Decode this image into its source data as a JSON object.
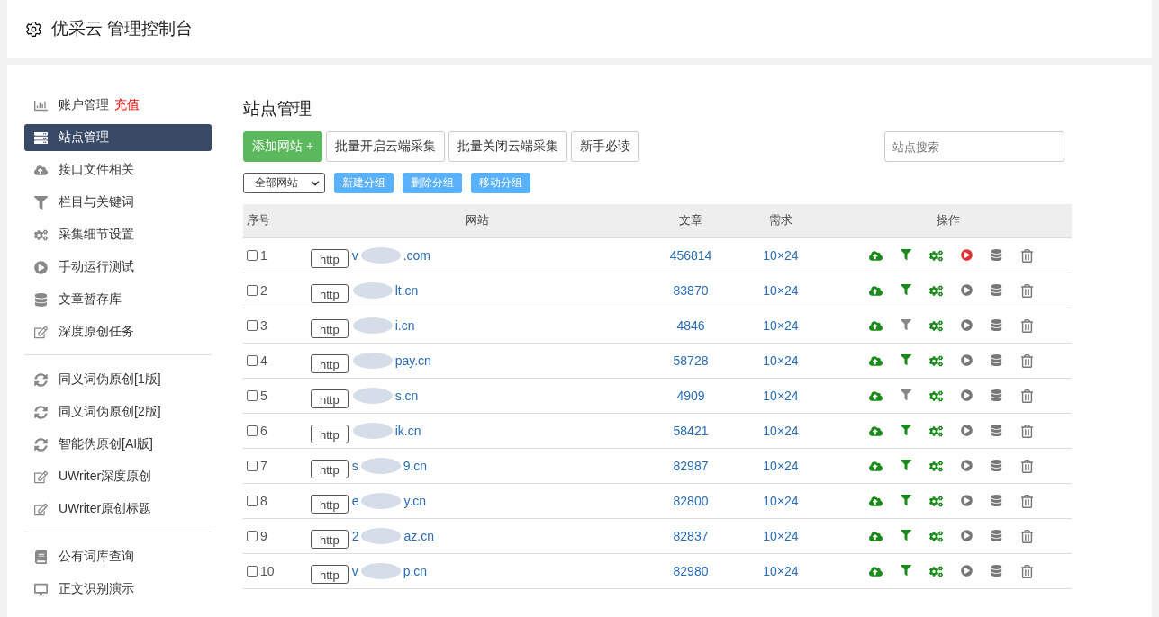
{
  "header": {
    "title": "优采云 管理控制台"
  },
  "sidebar": {
    "groups": [
      [
        {
          "label": "账户管理",
          "badge": "充值",
          "selected": false
        },
        {
          "label": "站点管理",
          "selected": true
        },
        {
          "label": "接口文件相关",
          "selected": false
        },
        {
          "label": "栏目与关键词",
          "selected": false
        },
        {
          "label": "采集细节设置",
          "selected": false
        },
        {
          "label": "手动运行测试",
          "selected": false
        },
        {
          "label": "文章暂存库",
          "selected": false
        },
        {
          "label": "深度原创任务",
          "selected": false
        }
      ],
      [
        {
          "label": "同义词伪原创[1版]",
          "selected": false
        },
        {
          "label": "同义词伪原创[2版]",
          "selected": false
        },
        {
          "label": "智能伪原创[AI版]",
          "selected": false
        },
        {
          "label": "UWriter深度原创",
          "selected": false
        },
        {
          "label": "UWriter原创标题",
          "selected": false
        }
      ],
      [
        {
          "label": "公有词库查询",
          "selected": false
        },
        {
          "label": "正文识别演示",
          "selected": false
        }
      ]
    ]
  },
  "main": {
    "title": "站点管理",
    "toolbar": [
      {
        "label": "添加网站 +",
        "kind": "primary"
      },
      {
        "label": "批量开启云端采集",
        "kind": "default"
      },
      {
        "label": "批量关闭云端采集",
        "kind": "default"
      },
      {
        "label": "新手必读",
        "kind": "default"
      }
    ],
    "search": {
      "placeholder": "站点搜索"
    },
    "group_select": {
      "value": "全部网站"
    },
    "group_buttons": [
      "新建分组",
      "删除分组",
      "移动分组"
    ],
    "table": {
      "columns": [
        "序号",
        "网站",
        "文章",
        "需求",
        "操作"
      ],
      "rows": [
        {
          "number": "1",
          "checked": false,
          "protocol": "http",
          "domain_start": "v",
          "domain_end": ".com",
          "articles": "456814",
          "demand": "10×24",
          "filter_on": true,
          "running": true
        },
        {
          "number": "2",
          "checked": false,
          "protocol": "http",
          "domain_start": "",
          "domain_end": "lt.cn",
          "articles": "83870",
          "demand": "10×24",
          "filter_on": true,
          "running": false
        },
        {
          "number": "3",
          "checked": false,
          "protocol": "http",
          "domain_start": "",
          "domain_end": "i.cn",
          "articles": "4846",
          "demand": "10×24",
          "filter_on": false,
          "running": false
        },
        {
          "number": "4",
          "checked": false,
          "protocol": "http",
          "domain_start": "",
          "domain_end": "pay.cn",
          "articles": "58728",
          "demand": "10×24",
          "filter_on": true,
          "running": false
        },
        {
          "number": "5",
          "checked": false,
          "protocol": "http",
          "domain_start": "",
          "domain_end": "s.cn",
          "articles": "4909",
          "demand": "10×24",
          "filter_on": false,
          "running": false
        },
        {
          "number": "6",
          "checked": false,
          "protocol": "http",
          "domain_start": "",
          "domain_end": "ik.cn",
          "articles": "58421",
          "demand": "10×24",
          "filter_on": true,
          "running": false
        },
        {
          "number": "7",
          "checked": false,
          "protocol": "http",
          "domain_start": "s",
          "domain_end": "9.cn",
          "articles": "82987",
          "demand": "10×24",
          "filter_on": true,
          "running": false
        },
        {
          "number": "8",
          "checked": false,
          "protocol": "http",
          "domain_start": "e",
          "domain_end": "y.cn",
          "articles": "82800",
          "demand": "10×24",
          "filter_on": true,
          "running": false
        },
        {
          "number": "9",
          "checked": false,
          "protocol": "http",
          "domain_start": "2",
          "domain_end": "az.cn",
          "articles": "82837",
          "demand": "10×24",
          "filter_on": true,
          "running": false
        },
        {
          "number": "10",
          "checked": false,
          "protocol": "http",
          "domain_start": "v",
          "domain_end": "p.cn",
          "articles": "82980",
          "demand": "10×24",
          "filter_on": true,
          "running": false
        }
      ]
    }
  }
}
